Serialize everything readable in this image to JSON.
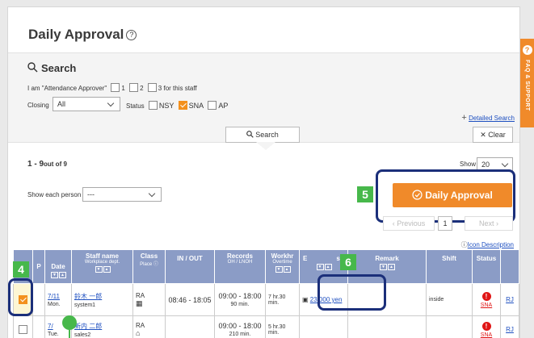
{
  "page": {
    "title": "Daily Approval",
    "help_glyph": "?"
  },
  "faq_tab": {
    "label": "FAQ & SUPPORT",
    "glyph": "?"
  },
  "search": {
    "title": "Search",
    "approver_text": "I am \"Attendance Approver\"",
    "approver_options": [
      "1",
      "2",
      "3 for this staff"
    ],
    "closing_label": "Closing",
    "closing_value": "All",
    "status_label": "Status",
    "status_options": [
      {
        "label": "NSY",
        "checked": false
      },
      {
        "label": "SNA",
        "checked": true
      },
      {
        "label": "AP",
        "checked": false
      }
    ],
    "detailed_search": "Detailed Search",
    "search_button": "Search",
    "clear_button": "Clear"
  },
  "results": {
    "range": "1 - 9",
    "out_of": "out of 9",
    "show_label": "Show",
    "show_value": "20",
    "show_each_label": "Show each person",
    "show_each_value": "---",
    "approve_button": "Daily Approval",
    "pager": {
      "previous": "Previous",
      "page": "1",
      "next": "Next"
    },
    "icon_description": "Icon Description"
  },
  "callouts": {
    "c4": "4",
    "c5": "5",
    "c6": "6"
  },
  "table": {
    "headers": {
      "p": "P",
      "date": "Date",
      "staff": "Staff name",
      "staff_sub": "Workplace dept.",
      "class": "Class",
      "class_sub": "Place",
      "inout": "IN / OUT",
      "records": "Records",
      "records_sub": "OH / LNOH",
      "workhr": "Workhr",
      "workhr_sub": "Overtime",
      "e": "E",
      "e_tail": "s",
      "remark": "Remark",
      "shift": "Shift",
      "status": "Status"
    },
    "rows": [
      {
        "date": "7/11",
        "day": "Mon.",
        "name": "鈴木 一郎",
        "dept": "system1",
        "class": "RA",
        "inout": "08:46 - 18:05",
        "records": "09:00 - 18:00",
        "records_sub": "90 min.",
        "workhr": "7 hr.30 min.",
        "expense": "23,000 yen",
        "shift": "inside",
        "status": "SNA",
        "rj": "RJ"
      },
      {
        "date": "7/",
        "day": "Tue.",
        "name": "新内 二郎",
        "dept": "sales2",
        "class": "RA",
        "inout": "",
        "records": "09:00 - 18:00",
        "records_sub": "210 min.",
        "workhr": "5 hr.30 min.",
        "expense": "",
        "shift": "",
        "status": "SNA",
        "rj": "RJ"
      }
    ]
  },
  "colors": {
    "accent": "#f08a2a",
    "header": "#8b9cc6",
    "callout": "#1b2f7a",
    "badge": "#47b84b"
  }
}
